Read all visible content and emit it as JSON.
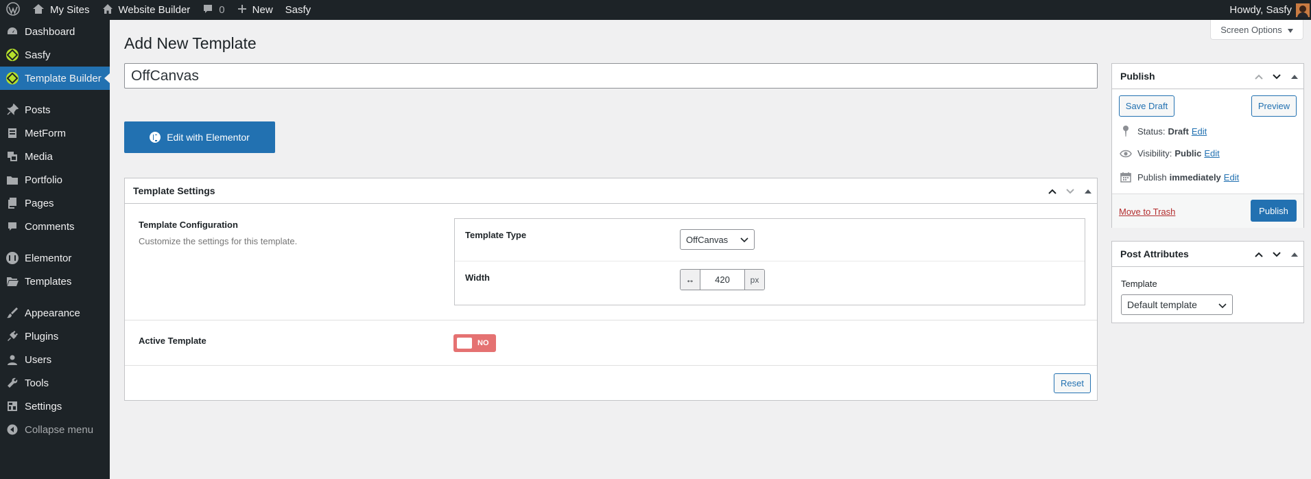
{
  "admin_bar": {
    "my_sites": "My Sites",
    "site_name": "Website Builder",
    "comments_count": "0",
    "new_label": "New",
    "sasfy": "Sasfy",
    "howdy": "Howdy, Sasfy"
  },
  "sidebar": {
    "items": [
      {
        "label": "Dashboard"
      },
      {
        "label": "Sasfy"
      },
      {
        "label": "Template Builder"
      },
      {
        "label": "Posts"
      },
      {
        "label": "MetForm"
      },
      {
        "label": "Media"
      },
      {
        "label": "Portfolio"
      },
      {
        "label": "Pages"
      },
      {
        "label": "Comments"
      },
      {
        "label": "Elementor"
      },
      {
        "label": "Templates"
      },
      {
        "label": "Appearance"
      },
      {
        "label": "Plugins"
      },
      {
        "label": "Users"
      },
      {
        "label": "Tools"
      },
      {
        "label": "Settings"
      },
      {
        "label": "Collapse menu"
      }
    ]
  },
  "screen_options": "Screen Options",
  "page": {
    "title": "Add New Template",
    "post_title_value": "OffCanvas",
    "edit_elementor": "Edit with Elementor"
  },
  "template_settings": {
    "header": "Template Settings",
    "config_label": "Template Configuration",
    "config_desc": "Customize the settings for this template.",
    "type_label": "Template Type",
    "type_value": "OffCanvas",
    "width_label": "Width",
    "width_prefix": "↔",
    "width_value": "420",
    "width_unit": "px",
    "active_label": "Active Template",
    "active_toggle": "NO",
    "reset": "Reset"
  },
  "publish": {
    "header": "Publish",
    "save_draft": "Save Draft",
    "preview": "Preview",
    "status_label": "Status:",
    "status_value": "Draft",
    "visibility_label": "Visibility:",
    "visibility_value": "Public",
    "publish_label": "Publish",
    "publish_value": "immediately",
    "edit": "Edit",
    "trash": "Move to Trash",
    "publish_button": "Publish"
  },
  "post_attributes": {
    "header": "Post Attributes",
    "template_label": "Template",
    "template_value": "Default template"
  },
  "colors": {
    "admin_dark": "#1d2327",
    "primary": "#2271b1",
    "background": "#f0f0f1",
    "toggle_off": "#e57272",
    "trash": "#b32d2e"
  }
}
